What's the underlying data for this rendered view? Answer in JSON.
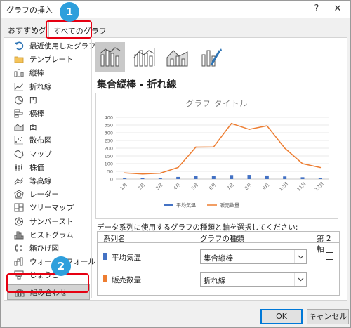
{
  "window": {
    "title": "グラフの挿入",
    "help_label": "?",
    "close_label": "✕"
  },
  "tabs": [
    {
      "label": "おすすめグラフ"
    },
    {
      "label": "すべてのグラフ"
    }
  ],
  "sidebar": {
    "items": [
      {
        "label": "最近使用したグラフ",
        "icon": "recent-undo-icon"
      },
      {
        "label": "テンプレート",
        "icon": "folder-icon"
      },
      {
        "label": "縦棒",
        "icon": "column-chart-icon"
      },
      {
        "label": "折れ線",
        "icon": "line-chart-icon"
      },
      {
        "label": "円",
        "icon": "pie-chart-icon"
      },
      {
        "label": "横棒",
        "icon": "bar-chart-icon"
      },
      {
        "label": "面",
        "icon": "area-chart-icon"
      },
      {
        "label": "散布図",
        "icon": "scatter-chart-icon"
      },
      {
        "label": "マップ",
        "icon": "map-chart-icon"
      },
      {
        "label": "株価",
        "icon": "stock-chart-icon"
      },
      {
        "label": "等高線",
        "icon": "surface-chart-icon"
      },
      {
        "label": "レーダー",
        "icon": "radar-chart-icon"
      },
      {
        "label": "ツリーマップ",
        "icon": "treemap-chart-icon"
      },
      {
        "label": "サンバースト",
        "icon": "sunburst-chart-icon"
      },
      {
        "label": "ヒストグラム",
        "icon": "histogram-chart-icon"
      },
      {
        "label": "箱ひげ図",
        "icon": "boxplot-chart-icon"
      },
      {
        "label": "ウォーターフォール",
        "icon": "waterfall-chart-icon"
      },
      {
        "label": "じょうご",
        "icon": "funnel-chart-icon"
      },
      {
        "label": "組み合わせ",
        "icon": "combo-chart-icon"
      }
    ]
  },
  "subtypes": [
    {
      "icon": "combo-column-line-icon"
    },
    {
      "icon": "combo-column-line-secondary-icon"
    },
    {
      "icon": "combo-area-column-icon"
    },
    {
      "icon": "custom-combo-icon"
    }
  ],
  "main": {
    "section_title": "集合縦棒 - 折れ線"
  },
  "chart_data": {
    "type": "bar",
    "title": "グラフ タイトル",
    "categories": [
      "1月",
      "2月",
      "3月",
      "4月",
      "5月",
      "6月",
      "7月",
      "8月",
      "9月",
      "10月",
      "11月",
      "12月"
    ],
    "ylim": [
      0,
      400
    ],
    "yticks": [
      0,
      50,
      100,
      150,
      200,
      250,
      300,
      350,
      400
    ],
    "series": [
      {
        "name": "平均気温",
        "type": "bar",
        "color": "#4472c4",
        "values": [
          5,
          6,
          9,
          14,
          19,
          22,
          26,
          27,
          23,
          17,
          12,
          7
        ]
      },
      {
        "name": "販売数量",
        "type": "line",
        "color": "#ed7d31",
        "values": [
          40,
          33,
          38,
          75,
          207,
          208,
          360,
          322,
          345,
          200,
          100,
          75
        ]
      }
    ],
    "legend": "bottom",
    "grid": true
  },
  "combo": {
    "instruction": "データ系列に使用するグラフの種類と軸を選択してください:",
    "headers": {
      "series_name": "系列名",
      "chart_type": "グラフの種類",
      "secondary_axis": "第 2 軸"
    },
    "rows": [
      {
        "name": "平均気温",
        "type": "集合縦棒",
        "secondary": false,
        "color": "#4472c4"
      },
      {
        "name": "販売数量",
        "type": "折れ線",
        "secondary": false,
        "color": "#ed7d31"
      }
    ]
  },
  "footer": {
    "ok_label": "OK",
    "cancel_label": "キャンセル"
  },
  "annotations": {
    "badge1": "1",
    "badge2": "2",
    "color": "#e60012"
  }
}
